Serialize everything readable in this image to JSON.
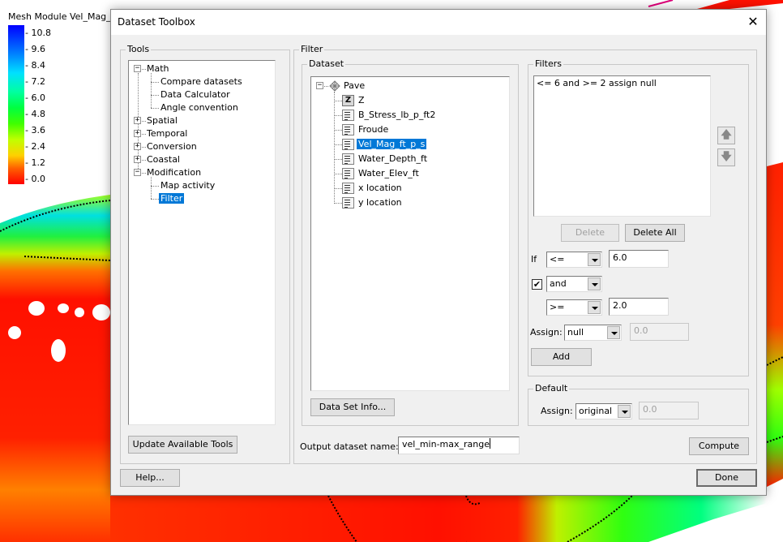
{
  "legend": {
    "title": "Mesh Module Vel_Mag_",
    "ticks": [
      "10.8",
      "9.6",
      "8.4",
      "7.2",
      "6.0",
      "4.8",
      "3.6",
      "2.4",
      "1.2",
      "0.0"
    ]
  },
  "dialog": {
    "title": "Dataset Toolbox",
    "close_label": "✕",
    "tools": {
      "group_label": "Tools",
      "tree": [
        {
          "label": "Math",
          "expander": "−",
          "children": [
            "Compare datasets",
            "Data Calculator",
            "Angle convention"
          ]
        },
        {
          "label": "Spatial",
          "expander": "+"
        },
        {
          "label": "Temporal",
          "expander": "+"
        },
        {
          "label": "Conversion",
          "expander": "+"
        },
        {
          "label": "Coastal",
          "expander": "+"
        },
        {
          "label": "Modification",
          "expander": "−",
          "children": [
            "Map activity",
            "Filter"
          ]
        }
      ],
      "selected": "Filter",
      "update_button": "Update Available Tools"
    },
    "filter": {
      "group_label": "Filter",
      "dataset": {
        "group_label": "Dataset",
        "root": "Pave",
        "items": [
          "Z",
          "B_Stress_lb_p_ft2",
          "Froude",
          "Vel_Mag_ft_p_s",
          "Water_Depth_ft",
          "Water_Elev_ft",
          "x location",
          "y location"
        ],
        "selected": "Vel_Mag_ft_p_s",
        "info_button": "Data Set Info..."
      },
      "filters": {
        "group_label": "Filters",
        "list": [
          "<= 6 and >= 2 assign null"
        ],
        "move_up_icon": "arrow-up",
        "move_down_icon": "arrow-down",
        "delete_button": "Delete",
        "delete_all_button": "Delete All",
        "if_label": "If",
        "op1": "<=",
        "val1": "6.0",
        "and_checked": true,
        "check_mark": "✔",
        "conj": "and",
        "op2": ">=",
        "val2": "2.0",
        "assign_label": "Assign:",
        "assign_value": "null",
        "assign_number": "0.0",
        "add_button": "Add"
      },
      "default": {
        "group_label": "Default",
        "assign_label": "Assign:",
        "assign_value": "original",
        "assign_number": "0.0"
      },
      "output_label": "Output dataset name:",
      "output_value": "vel_min-max_range",
      "compute_button": "Compute"
    },
    "help_button": "Help...",
    "done_button": "Done"
  }
}
